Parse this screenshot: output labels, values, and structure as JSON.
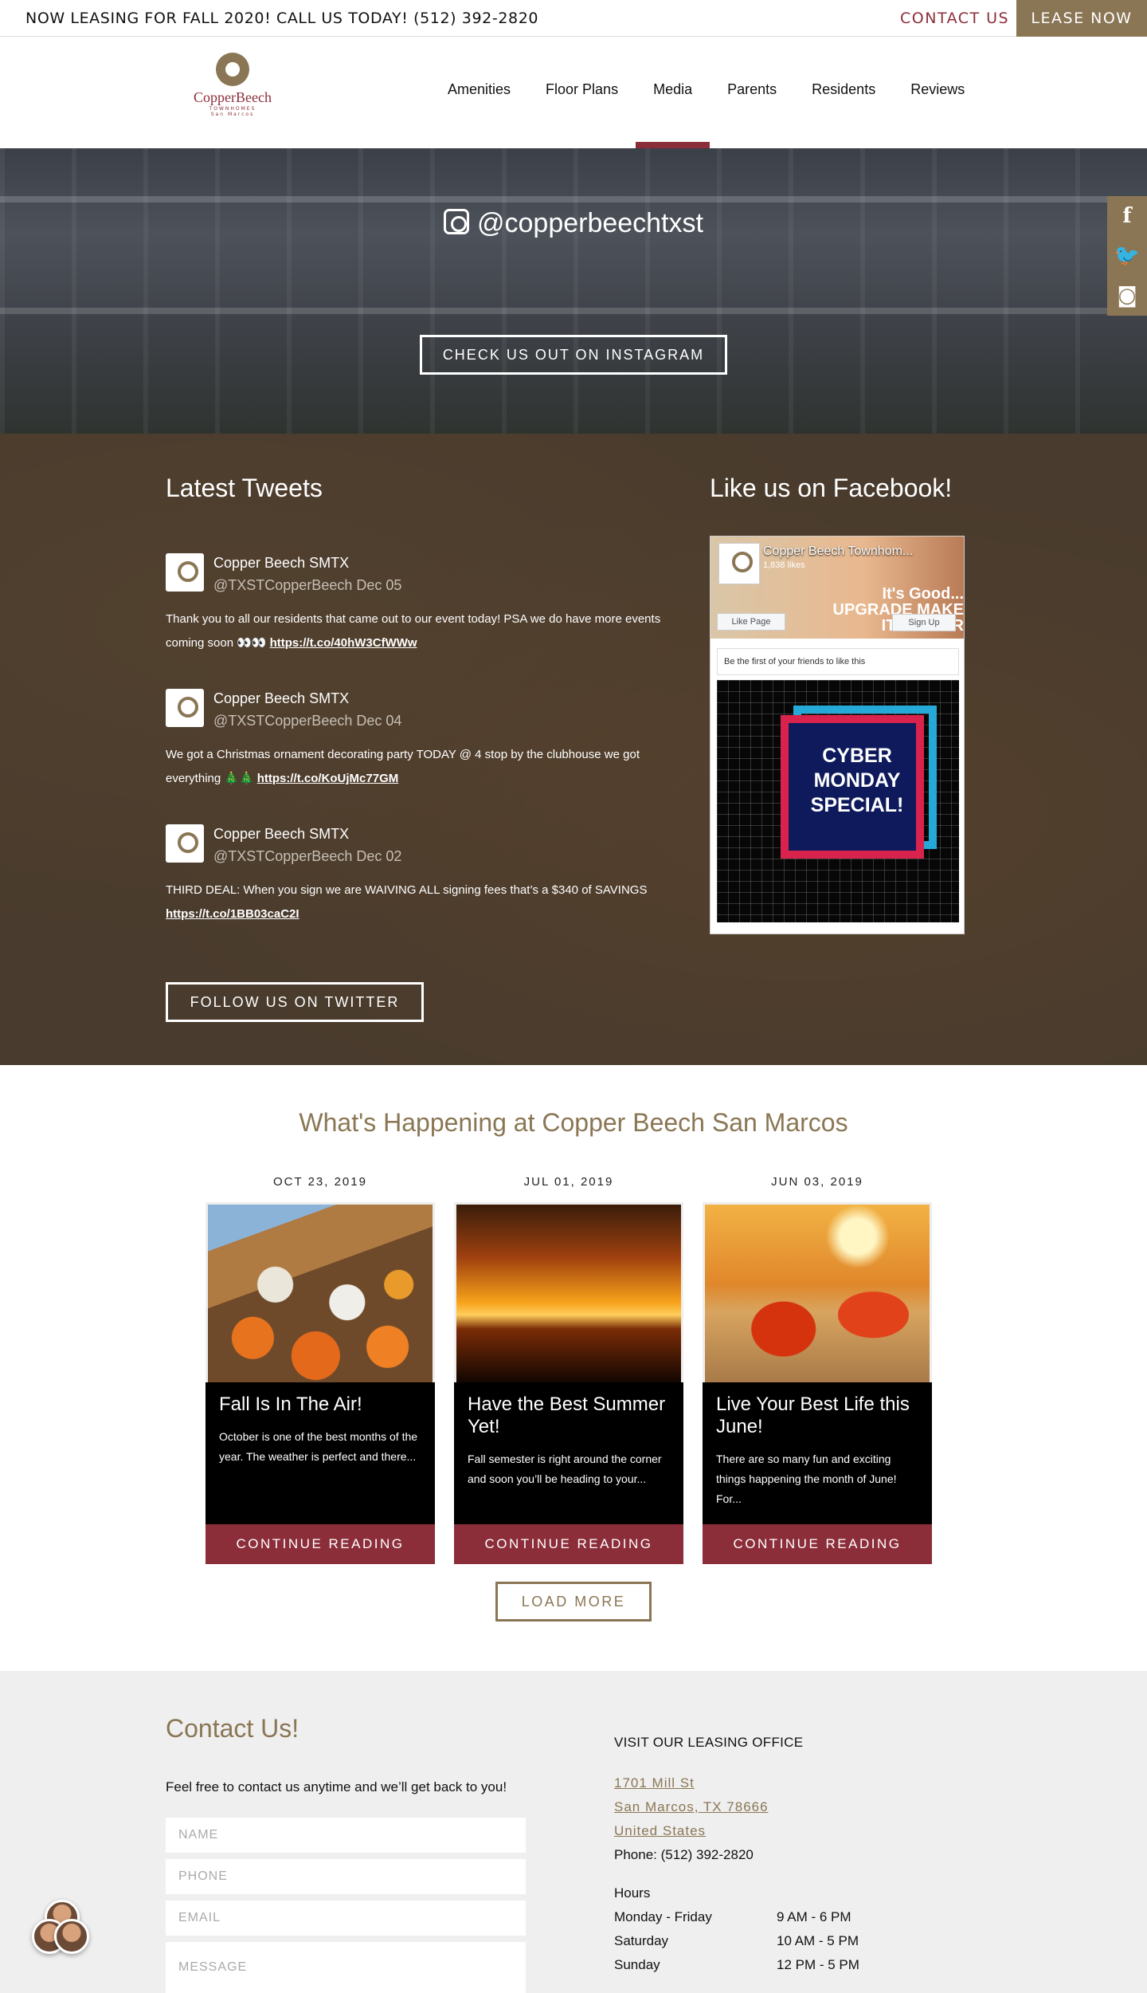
{
  "topbar": {
    "promo": "NOW LEASING FOR FALL 2020! CALL US TODAY! (512) 392-2820",
    "contact": "CONTACT US",
    "lease": "LEASE NOW"
  },
  "logo": {
    "name": "CopperBeech",
    "sub": "TOWNHOMES",
    "location": "San Marcos"
  },
  "nav": {
    "items": [
      "Amenities",
      "Floor Plans",
      "Media",
      "Parents",
      "Residents",
      "Reviews"
    ],
    "active": "Media"
  },
  "instagram": {
    "handle": "@copperbeechtxst",
    "button": "CHECK US OUT ON INSTAGRAM"
  },
  "social_icons": [
    "facebook-icon",
    "twitter-icon",
    "instagram-icon"
  ],
  "tweets_section": {
    "title": "Latest Tweets",
    "tweets": [
      {
        "name": "Copper Beech SMTX",
        "handle": "@TXSTCopperBeech Dec 05",
        "text": "Thank you to all our residents that came out to our event today! PSA we do have more events coming soon 👀👀",
        "link": "https://t.co/40hW3CfWWw"
      },
      {
        "name": "Copper Beech SMTX",
        "handle": "@TXSTCopperBeech Dec 04",
        "text": "We got a Christmas ornament decorating party TODAY @ 4 stop by the clubhouse we got everything 🎄🎄",
        "link": "https://t.co/KoUjMc77GM"
      },
      {
        "name": "Copper Beech SMTX",
        "handle": "@TXSTCopperBeech Dec 02",
        "text": "THIRD DEAL: When you sign we are WAIVING ALL signing fees that’s a $340 of SAVINGS",
        "link": "https://t.co/1BB03caC2I"
      }
    ],
    "button": "FOLLOW US ON TWITTER"
  },
  "facebook": {
    "title": "Like us on Facebook!",
    "page_name": "Copper Beech Townhom...",
    "likes": "1,838 likes",
    "slogan": "It's Good... UPGRADE MAKE IT BETTER",
    "like_page": "Like Page",
    "sign_up": "Sign Up",
    "friends": "Be the first of your friends to like this",
    "post_text": "CYBER MONDAY SPECIAL!"
  },
  "happenings": {
    "title": "What's Happening at Copper Beech San Marcos",
    "cards": [
      {
        "date": "OCT 23, 2019",
        "title": "Fall Is In The Air!",
        "excerpt": "October is one of the best months of the year. The weather is perfect and there...",
        "cta": "CONTINUE READING"
      },
      {
        "date": "JUL 01, 2019",
        "title": "Have the Best Summer Yet!",
        "excerpt": "Fall semester is right around the corner and soon you’ll be heading to your...",
        "cta": "CONTINUE READING"
      },
      {
        "date": "JUN 03, 2019",
        "title": "Live Your Best Life this June!",
        "excerpt": "There are so many fun and exciting things happening the month of June! For...",
        "cta": "CONTINUE READING"
      }
    ],
    "load_more": "LOAD MORE"
  },
  "contact": {
    "title": "Contact Us!",
    "intro": "Feel free to contact us anytime and we’ll get back to you!",
    "fields": {
      "name": "NAME",
      "phone": "PHONE",
      "email": "EMAIL",
      "message": "MESSAGE"
    },
    "office_title": "VISIT OUR LEASING OFFICE",
    "address": [
      "1701 Mill St",
      "San Marcos, TX 78666",
      "United States"
    ],
    "phone": "Phone: (512) 392-2820",
    "hours_title": "Hours",
    "hours": [
      {
        "day": "Monday - Friday",
        "time": "9 AM - 6 PM"
      },
      {
        "day": "Saturday",
        "time": "10 AM - 5 PM"
      },
      {
        "day": "Sunday",
        "time": "12 PM - 5 PM"
      }
    ]
  }
}
